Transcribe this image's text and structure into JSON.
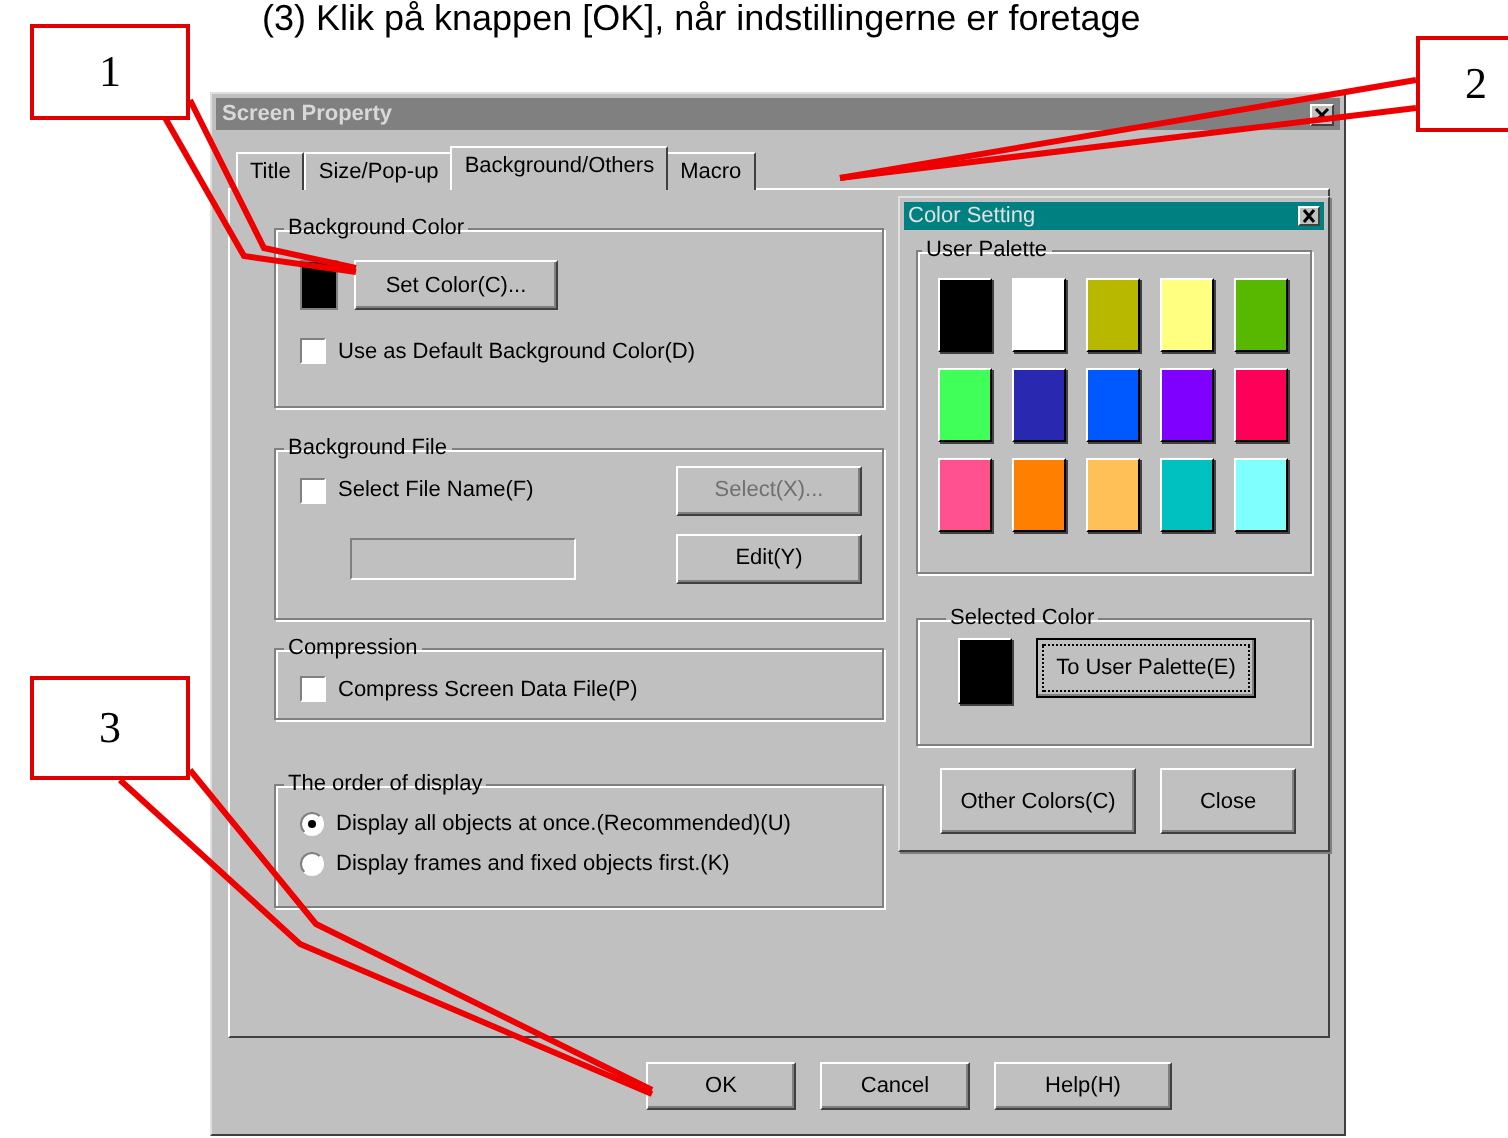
{
  "caption": "(3) Klik på knappen [OK], når indstillingerne er foretage",
  "dialog": {
    "title": "Screen Property",
    "tabs": [
      {
        "label": "Title",
        "selected": false
      },
      {
        "label": "Size/Pop-up",
        "selected": false
      },
      {
        "label": "Background/Others",
        "selected": true
      },
      {
        "label": "Macro",
        "selected": false
      }
    ],
    "background_color": {
      "title": "Background Color",
      "color": "#000000",
      "button": "Set Color(C)...",
      "checkbox": {
        "label": "Use as Default Background Color(D)",
        "checked": false
      }
    },
    "background_file": {
      "title": "Background File",
      "checkbox": {
        "label": "Select File Name(F)",
        "checked": false
      },
      "select_button": {
        "label": "Select(X)...",
        "disabled": true
      },
      "edit_button": {
        "label": "Edit(Y)",
        "disabled": false
      }
    },
    "compression": {
      "title": "Compression",
      "checkbox": {
        "label": "Compress Screen Data File(P)",
        "checked": false
      }
    },
    "display_order": {
      "title": "The order of display",
      "options": [
        {
          "label": "Display all objects at once.(Recommended)(U)",
          "selected": true
        },
        {
          "label": "Display frames and fixed objects first.(K)",
          "selected": false
        }
      ]
    },
    "buttons": [
      {
        "label": "OK"
      },
      {
        "label": "Cancel"
      },
      {
        "label": "Help(H)"
      }
    ]
  },
  "color_setting": {
    "title": "Color Setting",
    "palette_title": "User Palette",
    "palette": [
      {
        "color": "#000000"
      },
      {
        "color": "#ffffff"
      },
      {
        "color": "#b8b800"
      },
      {
        "color": "#ffff80"
      },
      {
        "color": "#58b800"
      },
      {
        "color": "#40ff58"
      },
      {
        "color": "#2828b0"
      },
      {
        "color": "#0058ff"
      },
      {
        "color": "#8000ff"
      },
      {
        "color": "#ff0058"
      },
      {
        "color": "#ff5090"
      },
      {
        "color": "#ff8000"
      },
      {
        "color": "#ffc058"
      },
      {
        "color": "#00c0c0"
      },
      {
        "color": "#80ffff"
      }
    ],
    "selected_title": "Selected Color",
    "color": "#000000",
    "to_palette_button": "To User Palette(E)",
    "buttons": [
      {
        "label": "Other Colors(C)"
      },
      {
        "label": "Close"
      }
    ]
  },
  "callouts": [
    {
      "label": "1"
    },
    {
      "label": "2"
    },
    {
      "label": "3"
    }
  ]
}
